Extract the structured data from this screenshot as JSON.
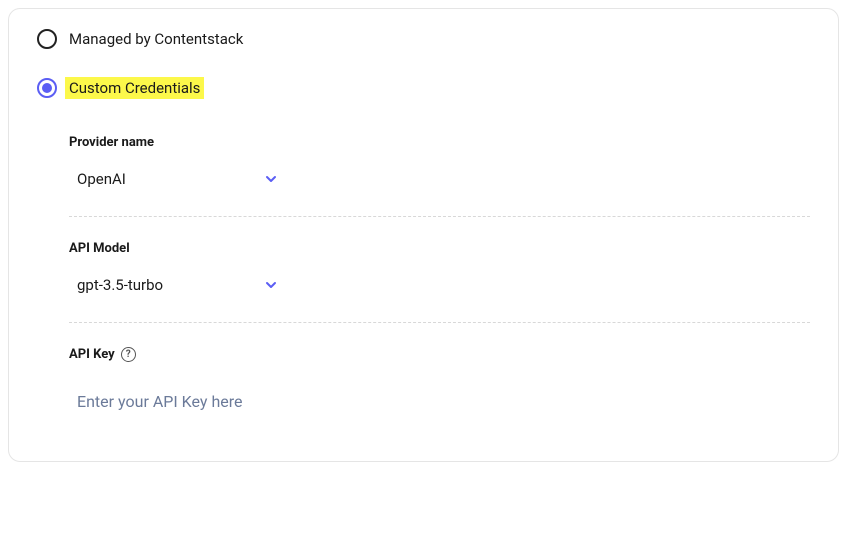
{
  "radios": {
    "managed": {
      "label": "Managed by Contentstack",
      "selected": false
    },
    "custom": {
      "label": "Custom Credentials",
      "selected": true,
      "highlight": "#fcf84a"
    }
  },
  "fields": {
    "provider": {
      "label": "Provider name",
      "value": "OpenAI"
    },
    "model": {
      "label": "API Model",
      "value": "gpt-3.5-turbo"
    },
    "apiKey": {
      "label": "API Key",
      "value": "",
      "placeholder": "Enter your API Key here"
    }
  }
}
